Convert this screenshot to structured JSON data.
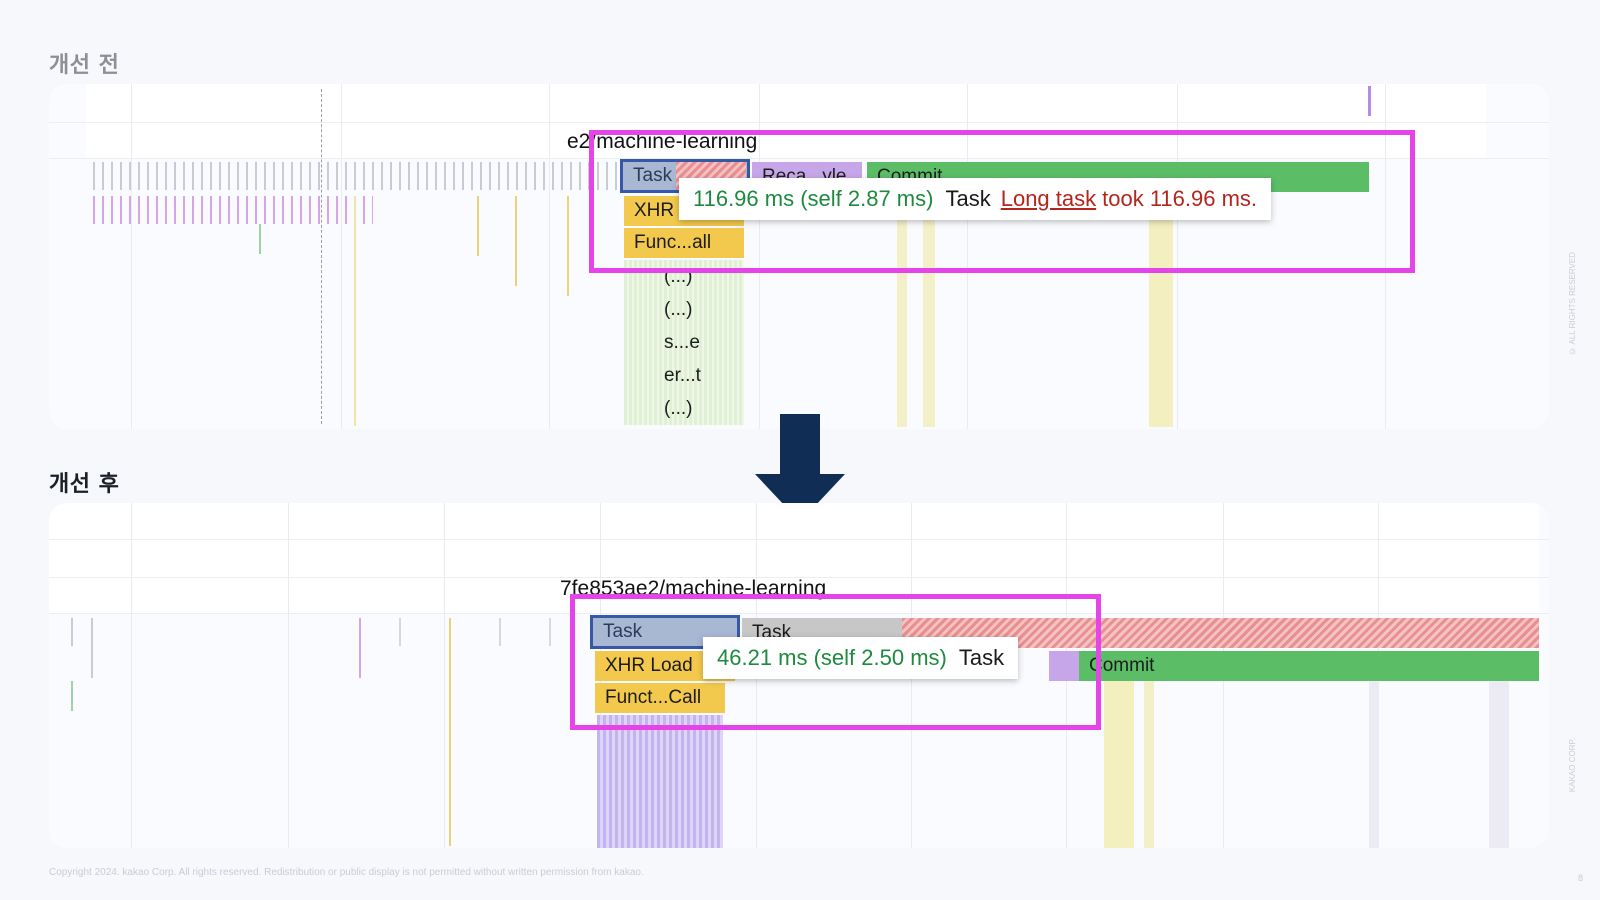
{
  "before": {
    "title": "개선 전",
    "url_fragment": "e2/machine-learning",
    "task_label": "Task",
    "xhr_label": "XHR",
    "func_label": "Func...all",
    "recalc_label": "Reca...yle",
    "commit_label": "Commit",
    "stack": [
      "(...)",
      "(...)",
      "s...e",
      "er...t",
      "(...)"
    ],
    "tooltip": {
      "time": "116.96 ms (self 2.87 ms)",
      "name": "Task",
      "warning_link": "Long task",
      "warning_text": "took 116.96 ms."
    }
  },
  "after": {
    "title": "개선 후",
    "url_fragment": "7fe853ae2/machine-learning",
    "task_label": "Task",
    "task2_label": "Task",
    "xhr_label": "XHR Load",
    "func_label": "Funct...Call",
    "commit_label": "Commit",
    "tooltip": {
      "time": "46.21 ms (self 2.50 ms)",
      "name": "Task"
    }
  },
  "footer": "Copyright 2024. kakao Corp. All rights reserved. Redistribution or public display is not permitted without written permission from kakao.",
  "side_text_top": "© ALL RIGHTS RESERVED",
  "side_text_bottom": "KAKAO CORP.",
  "page_number": "8",
  "colors": {
    "highlight": "#e545e8",
    "arrow": "#0f2d55",
    "commit": "#5cbd67",
    "task_selected": "#3558a7"
  }
}
